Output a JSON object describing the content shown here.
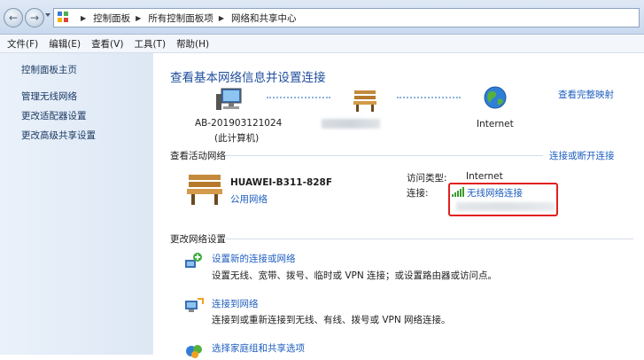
{
  "breadcrumb": {
    "items": [
      "控制面板",
      "所有控制面板项",
      "网络和共享中心"
    ]
  },
  "menu": {
    "file": "文件(F)",
    "edit": "编辑(E)",
    "view": "查看(V)",
    "tools": "工具(T)",
    "help": "帮助(H)"
  },
  "sidebar": {
    "items": [
      {
        "label": "控制面板主页"
      },
      {
        "label": "管理无线网络"
      },
      {
        "label": "更改适配器设置"
      },
      {
        "label": "更改高级共享设置"
      }
    ]
  },
  "main": {
    "title": "查看基本网络信息并设置连接",
    "full_map_link": "查看完整映射",
    "map": {
      "computer_name": "AB-201903121024",
      "computer_sub": "(此计算机)",
      "internet_label": "Internet"
    },
    "active_networks_title": "查看活动网络",
    "connect_disconnect_link": "连接或断开连接",
    "network": {
      "name": "HUAWEI-B311-828F",
      "type": "公用网络",
      "access_type_label": "访问类型:",
      "access_type_value": "Internet",
      "connection_label": "连接:",
      "connection_value": "无线网络连接"
    },
    "change_settings_title": "更改网络设置",
    "tasks": [
      {
        "title": "设置新的连接或网络",
        "desc": "设置无线、宽带、拨号、临时或 VPN 连接；或设置路由器或访问点。"
      },
      {
        "title": "连接到网络",
        "desc": "连接到或重新连接到无线、有线、拨号或 VPN 网络连接。"
      },
      {
        "title": "选择家庭组和共享选项",
        "desc": ""
      }
    ]
  },
  "colors": {
    "link": "#1f5fbf",
    "title": "#1f4e9c",
    "highlight_box": "#e02020",
    "sidebar_bg": "#dde8f5"
  }
}
